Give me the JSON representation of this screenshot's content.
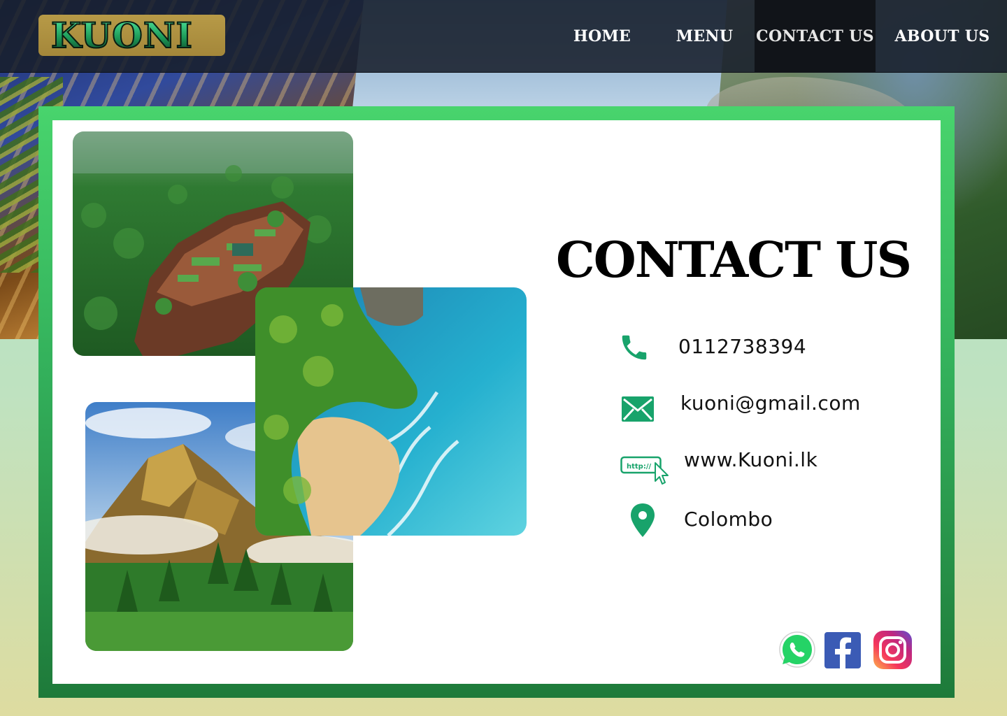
{
  "header": {
    "logo_text": "KUONI",
    "nav": [
      {
        "label": "HOME"
      },
      {
        "label": "MENU"
      },
      {
        "label": "CONTACT US",
        "active": true
      },
      {
        "label": "ABOUT  US"
      }
    ]
  },
  "main": {
    "heading": "CONTACT US",
    "contacts": {
      "phone": {
        "icon": "phone-icon",
        "text": "0112738394"
      },
      "email": {
        "icon": "mail-icon",
        "text": "kuoni@gmail.com"
      },
      "website": {
        "icon": "web-link-icon",
        "icon_text": "http://",
        "text": "www.Kuoni.lk"
      },
      "location": {
        "icon": "map-pin-icon",
        "text": "Colombo"
      }
    },
    "social": [
      "whatsapp-icon",
      "facebook-icon",
      "instagram-icon"
    ]
  },
  "colors": {
    "accent_green": "#2fbf74",
    "frame_green": "#33b05b",
    "nav_bg": "#181f2b",
    "logo_gold": "#b79a47",
    "icon_teal": "#18a36b"
  }
}
